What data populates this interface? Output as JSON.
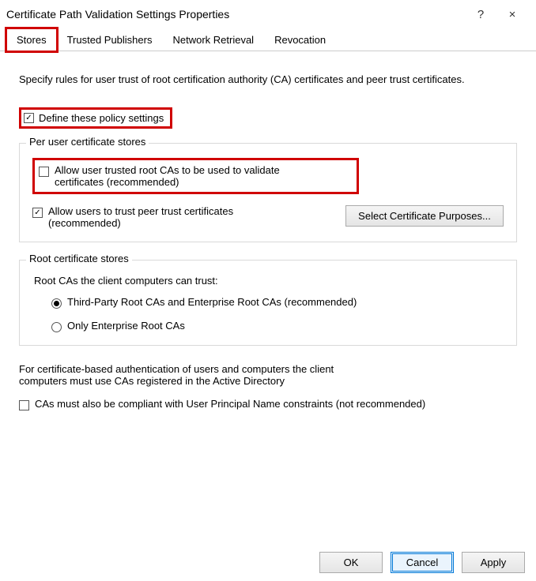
{
  "titlebar": {
    "title": "Certificate Path Validation Settings Properties",
    "help": "?",
    "close": "×"
  },
  "tabs": {
    "stores": "Stores",
    "trusted": "Trusted Publishers",
    "network": "Network Retrieval",
    "revocation": "Revocation"
  },
  "intro": "Specify rules for user trust of root certification authority (CA) certificates and peer trust certificates.",
  "define": {
    "label": "Define these policy settings",
    "check": "✓"
  },
  "per_user": {
    "title": "Per user certificate stores",
    "allow_root": "Allow user trusted root CAs to be used to validate certificates (recommended)",
    "allow_peer": "Allow users to trust peer trust certificates (recommended)",
    "peer_check": "✓",
    "select_button": "Select Certificate Purposes..."
  },
  "root_stores": {
    "title": "Root certificate stores",
    "intro": "Root CAs the client computers can trust:",
    "opt_third": "Third-Party Root CAs and Enterprise Root CAs (recommended)",
    "opt_enterprise": "Only Enterprise Root CAs"
  },
  "auth_note": "For certificate-based authentication of users and computers the client computers must use CAs registered in the Active Directory",
  "upn_label": "CAs must also be compliant with User Principal Name constraints (not recommended)",
  "buttons": {
    "ok": "OK",
    "cancel": "Cancel",
    "apply": "Apply"
  }
}
